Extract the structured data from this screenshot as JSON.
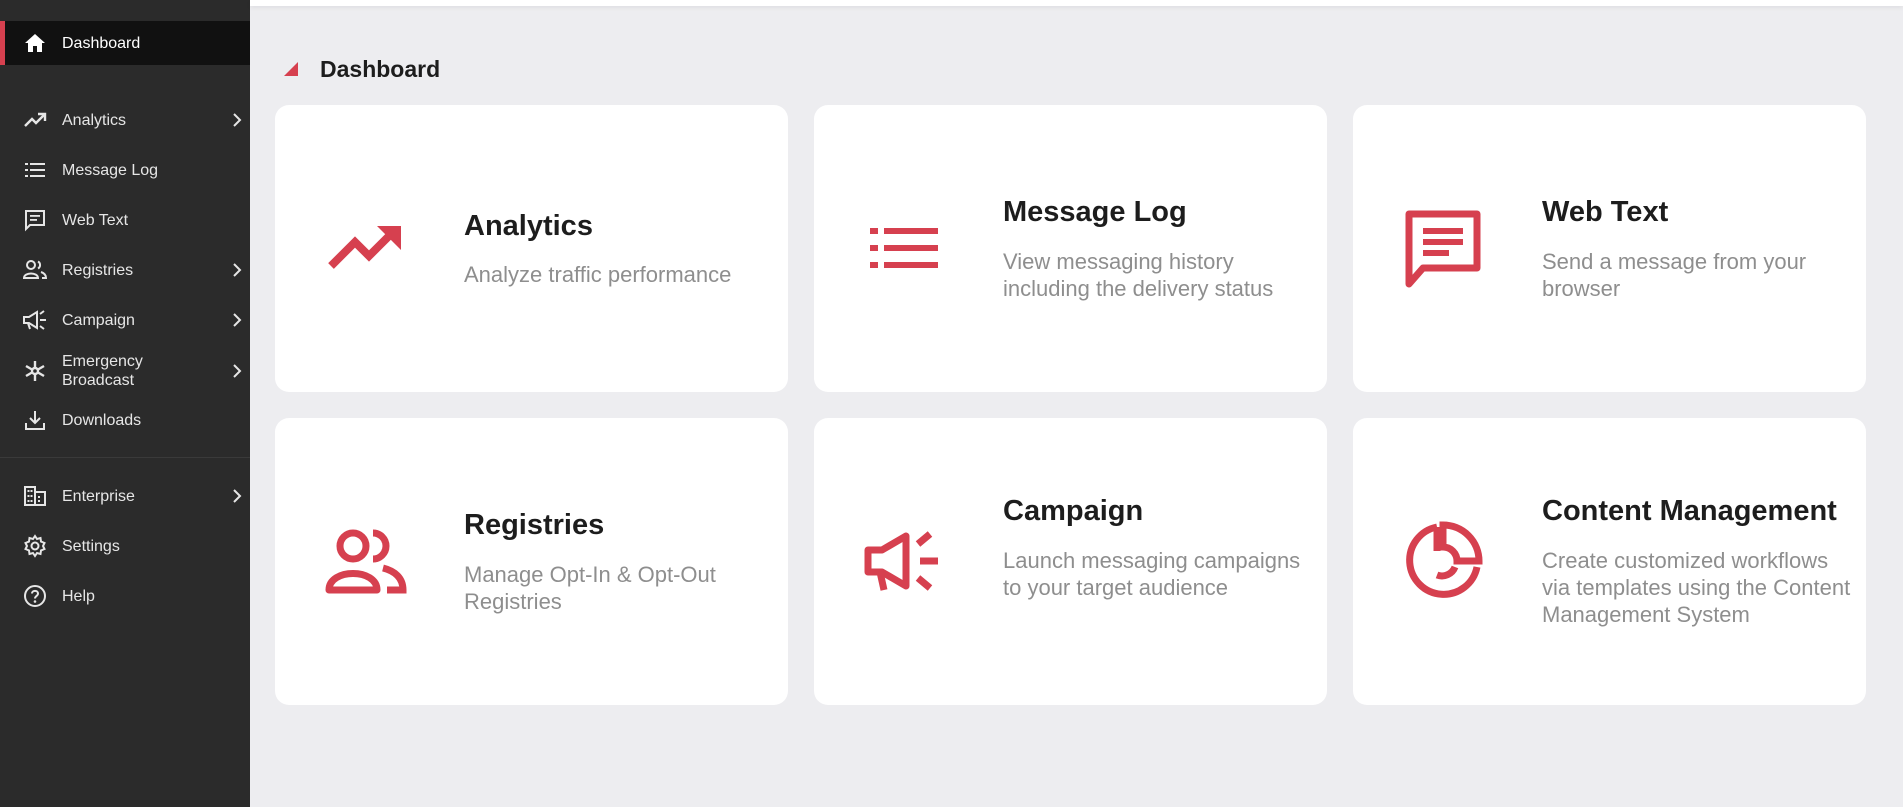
{
  "sidebar": {
    "items": [
      {
        "label": "Dashboard",
        "icon": "home-icon"
      },
      {
        "label": "Analytics",
        "icon": "trending-up-icon"
      },
      {
        "label": "Message Log",
        "icon": "list-icon"
      },
      {
        "label": "Web Text",
        "icon": "message-icon"
      },
      {
        "label": "Registries",
        "icon": "people-icon"
      },
      {
        "label": "Campaign",
        "icon": "megaphone-icon"
      },
      {
        "label": "Emergency Broadcast",
        "icon": "emergency-icon"
      },
      {
        "label": "Downloads",
        "icon": "download-icon"
      },
      {
        "label": "Enterprise",
        "icon": "building-icon"
      },
      {
        "label": "Settings",
        "icon": "gear-icon"
      },
      {
        "label": "Help",
        "icon": "help-icon"
      }
    ]
  },
  "main": {
    "title": "Dashboard",
    "cards": [
      {
        "title": "Analytics",
        "description": "Analyze traffic performance",
        "icon": "trending-up-icon"
      },
      {
        "title": "Message Log",
        "description": "View messaging history including the delivery status",
        "icon": "list-icon"
      },
      {
        "title": "Web Text",
        "description": "Send a message from your browser",
        "icon": "message-icon"
      },
      {
        "title": "Registries",
        "description": "Manage Opt-In & Opt-Out Registries",
        "icon": "people-icon"
      },
      {
        "title": "Campaign",
        "description": "Launch messaging campaigns to your target audience",
        "icon": "megaphone-icon"
      },
      {
        "title": "Content Management",
        "description": "Create customized workflows via templates using the Content Management System",
        "icon": "pie-icon"
      }
    ]
  },
  "colors": {
    "accent": "#d6404f",
    "sidebar_bg": "#2b2b2b",
    "sidebar_active_bg": "#111111",
    "page_bg": "#ededf0",
    "card_bg": "#ffffff"
  }
}
